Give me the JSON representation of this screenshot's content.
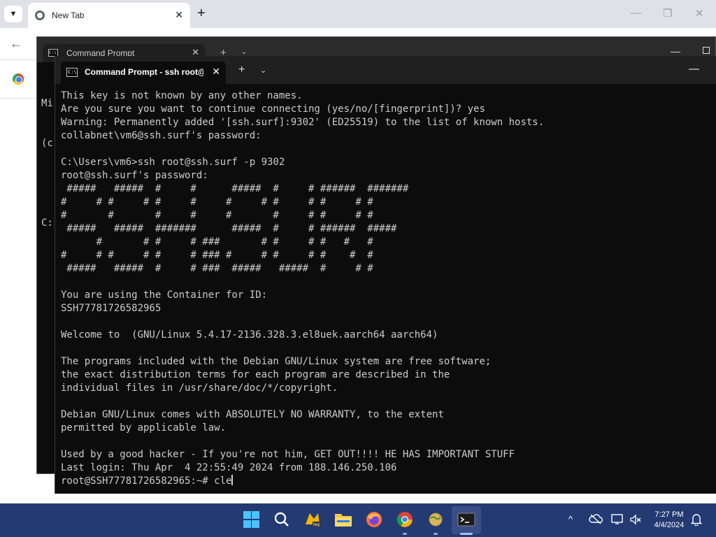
{
  "chrome": {
    "tab_title": "New Tab",
    "tab_close": "✕",
    "new_tab": "+",
    "minimize": "—",
    "restore": "❐",
    "close": "✕",
    "back": "←"
  },
  "back_terminal": {
    "tab_title": "Command Prompt",
    "tab_close": "✕",
    "plus": "+",
    "chevron": "⌄",
    "minimize": "—",
    "visible_lines": [
      "Mi",
      "(c",
      "",
      "C:"
    ]
  },
  "terminal": {
    "tab_title": "Command Prompt - ssh  root@",
    "tab_close": "✕",
    "plus": "+",
    "chevron": "⌄",
    "minimize": "—",
    "lines": [
      "This key is not known by any other names.",
      "Are you sure you want to continue connecting (yes/no/[fingerprint])? yes",
      "Warning: Permanently added '[ssh.surf]:9302' (ED25519) to the list of known hosts.",
      "collabnet\\vm6@ssh.surf's password:",
      "",
      "C:\\Users\\vm6>ssh root@ssh.surf -p 9302",
      "root@ssh.surf's password:",
      " #####   #####  #     #      #####  #     # ######  #######",
      "#     # #     # #     #     #     # #     # #     # #",
      "#       #       #     #     #       #     # #     # #",
      " #####   #####  #######      #####  #     # ######  #####",
      "      #       # #     # ###       # #     # #   #   #",
      "#     # #     # #     # ### #     # #     # #    #  #",
      " #####   #####  #     # ###  #####   #####  #     # #",
      "",
      "You are using the Container for ID:",
      "SSH77781726582965",
      "",
      "Welcome to  (GNU/Linux 5.4.17-2136.328.3.el8uek.aarch64 aarch64)",
      "",
      "The programs included with the Debian GNU/Linux system are free software;",
      "the exact distribution terms for each program are described in the",
      "individual files in /usr/share/doc/*/copyright.",
      "",
      "Debian GNU/Linux comes with ABSOLUTELY NO WARRANTY, to the extent",
      "permitted by applicable law.",
      "",
      "Used by a good hacker - If you're not him, GET OUT!!!! HE HAS IMPORTANT STUFF",
      "Last login: Thu Apr  4 22:55:49 2024 from 188.146.250.106"
    ],
    "prompt": "root@SSH77781726582965:~# ",
    "typed": "cle"
  },
  "taskbar": {
    "icons": [
      "windows-start-icon",
      "search-icon",
      "app-pre-icon",
      "file-explorer-icon",
      "firefox-icon",
      "chrome-icon",
      "globe-app-icon",
      "terminal-icon"
    ],
    "time": "7:27 PM",
    "date": "4/4/2024",
    "tray_chevron": "^"
  },
  "colors": {
    "taskbar": "#243a73",
    "terminal_bg": "#0c0c0c",
    "terminal_text": "#cccccc",
    "windows_accent": "#4cc2ff"
  }
}
